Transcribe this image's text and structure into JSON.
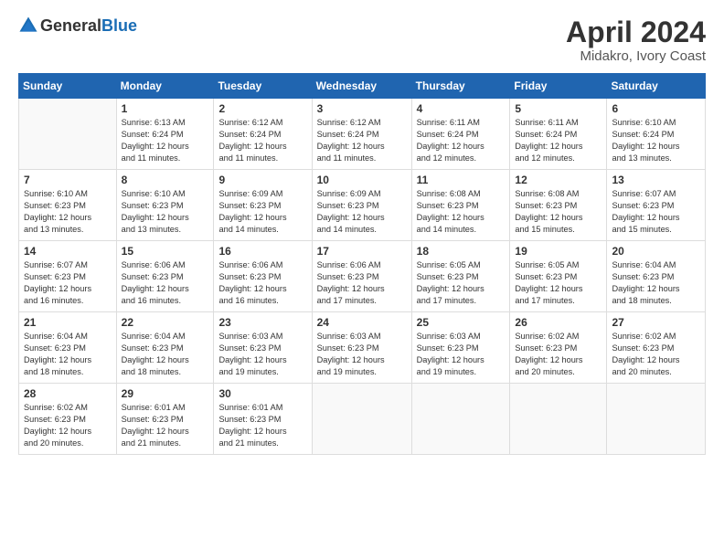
{
  "header": {
    "logo": {
      "general": "General",
      "blue": "Blue"
    },
    "month": "April 2024",
    "location": "Midakro, Ivory Coast"
  },
  "weekdays": [
    "Sunday",
    "Monday",
    "Tuesday",
    "Wednesday",
    "Thursday",
    "Friday",
    "Saturday"
  ],
  "weeks": [
    [
      {
        "day": "",
        "info": ""
      },
      {
        "day": "1",
        "info": "Sunrise: 6:13 AM\nSunset: 6:24 PM\nDaylight: 12 hours\nand 11 minutes."
      },
      {
        "day": "2",
        "info": "Sunrise: 6:12 AM\nSunset: 6:24 PM\nDaylight: 12 hours\nand 11 minutes."
      },
      {
        "day": "3",
        "info": "Sunrise: 6:12 AM\nSunset: 6:24 PM\nDaylight: 12 hours\nand 11 minutes."
      },
      {
        "day": "4",
        "info": "Sunrise: 6:11 AM\nSunset: 6:24 PM\nDaylight: 12 hours\nand 12 minutes."
      },
      {
        "day": "5",
        "info": "Sunrise: 6:11 AM\nSunset: 6:24 PM\nDaylight: 12 hours\nand 12 minutes."
      },
      {
        "day": "6",
        "info": "Sunrise: 6:10 AM\nSunset: 6:24 PM\nDaylight: 12 hours\nand 13 minutes."
      }
    ],
    [
      {
        "day": "7",
        "info": "Sunrise: 6:10 AM\nSunset: 6:23 PM\nDaylight: 12 hours\nand 13 minutes."
      },
      {
        "day": "8",
        "info": "Sunrise: 6:10 AM\nSunset: 6:23 PM\nDaylight: 12 hours\nand 13 minutes."
      },
      {
        "day": "9",
        "info": "Sunrise: 6:09 AM\nSunset: 6:23 PM\nDaylight: 12 hours\nand 14 minutes."
      },
      {
        "day": "10",
        "info": "Sunrise: 6:09 AM\nSunset: 6:23 PM\nDaylight: 12 hours\nand 14 minutes."
      },
      {
        "day": "11",
        "info": "Sunrise: 6:08 AM\nSunset: 6:23 PM\nDaylight: 12 hours\nand 14 minutes."
      },
      {
        "day": "12",
        "info": "Sunrise: 6:08 AM\nSunset: 6:23 PM\nDaylight: 12 hours\nand 15 minutes."
      },
      {
        "day": "13",
        "info": "Sunrise: 6:07 AM\nSunset: 6:23 PM\nDaylight: 12 hours\nand 15 minutes."
      }
    ],
    [
      {
        "day": "14",
        "info": "Sunrise: 6:07 AM\nSunset: 6:23 PM\nDaylight: 12 hours\nand 16 minutes."
      },
      {
        "day": "15",
        "info": "Sunrise: 6:06 AM\nSunset: 6:23 PM\nDaylight: 12 hours\nand 16 minutes."
      },
      {
        "day": "16",
        "info": "Sunrise: 6:06 AM\nSunset: 6:23 PM\nDaylight: 12 hours\nand 16 minutes."
      },
      {
        "day": "17",
        "info": "Sunrise: 6:06 AM\nSunset: 6:23 PM\nDaylight: 12 hours\nand 17 minutes."
      },
      {
        "day": "18",
        "info": "Sunrise: 6:05 AM\nSunset: 6:23 PM\nDaylight: 12 hours\nand 17 minutes."
      },
      {
        "day": "19",
        "info": "Sunrise: 6:05 AM\nSunset: 6:23 PM\nDaylight: 12 hours\nand 17 minutes."
      },
      {
        "day": "20",
        "info": "Sunrise: 6:04 AM\nSunset: 6:23 PM\nDaylight: 12 hours\nand 18 minutes."
      }
    ],
    [
      {
        "day": "21",
        "info": "Sunrise: 6:04 AM\nSunset: 6:23 PM\nDaylight: 12 hours\nand 18 minutes."
      },
      {
        "day": "22",
        "info": "Sunrise: 6:04 AM\nSunset: 6:23 PM\nDaylight: 12 hours\nand 18 minutes."
      },
      {
        "day": "23",
        "info": "Sunrise: 6:03 AM\nSunset: 6:23 PM\nDaylight: 12 hours\nand 19 minutes."
      },
      {
        "day": "24",
        "info": "Sunrise: 6:03 AM\nSunset: 6:23 PM\nDaylight: 12 hours\nand 19 minutes."
      },
      {
        "day": "25",
        "info": "Sunrise: 6:03 AM\nSunset: 6:23 PM\nDaylight: 12 hours\nand 19 minutes."
      },
      {
        "day": "26",
        "info": "Sunrise: 6:02 AM\nSunset: 6:23 PM\nDaylight: 12 hours\nand 20 minutes."
      },
      {
        "day": "27",
        "info": "Sunrise: 6:02 AM\nSunset: 6:23 PM\nDaylight: 12 hours\nand 20 minutes."
      }
    ],
    [
      {
        "day": "28",
        "info": "Sunrise: 6:02 AM\nSunset: 6:23 PM\nDaylight: 12 hours\nand 20 minutes."
      },
      {
        "day": "29",
        "info": "Sunrise: 6:01 AM\nSunset: 6:23 PM\nDaylight: 12 hours\nand 21 minutes."
      },
      {
        "day": "30",
        "info": "Sunrise: 6:01 AM\nSunset: 6:23 PM\nDaylight: 12 hours\nand 21 minutes."
      },
      {
        "day": "",
        "info": ""
      },
      {
        "day": "",
        "info": ""
      },
      {
        "day": "",
        "info": ""
      },
      {
        "day": "",
        "info": ""
      }
    ]
  ]
}
